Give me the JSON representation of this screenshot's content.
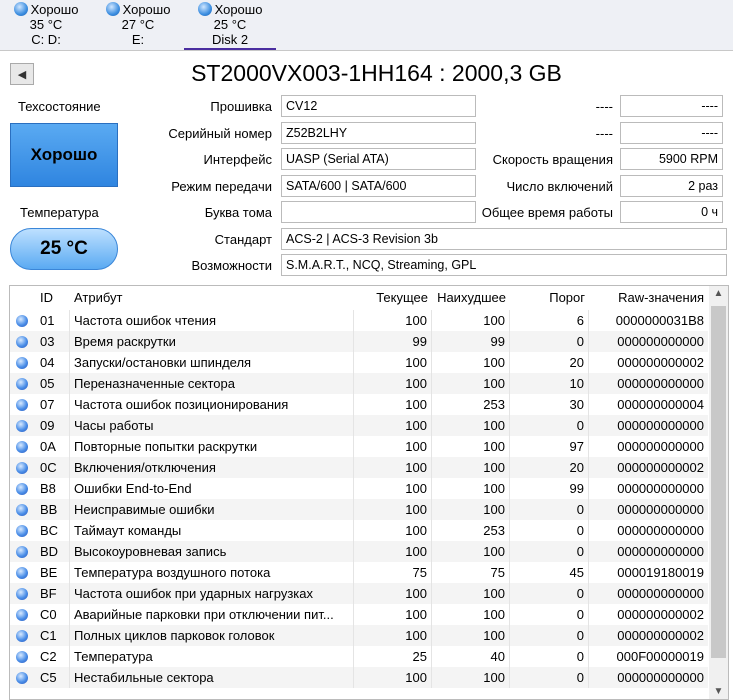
{
  "tabs": [
    {
      "status": "Хорошо",
      "temp": "35 °C",
      "drive": "C: D:"
    },
    {
      "status": "Хорошо",
      "temp": "27 °C",
      "drive": "E:"
    },
    {
      "status": "Хорошо",
      "temp": "25 °C",
      "drive": "Disk 2"
    }
  ],
  "title": "ST2000VX003-1HH164 : 2000,3 GB",
  "health_label": "Техсостояние",
  "health": "Хорошо",
  "temp_label": "Температура",
  "temp": "25 °C",
  "fields": [
    {
      "label": "Прошивка",
      "value": "CV12"
    },
    {
      "label": "Серийный номер",
      "value": "Z52B2LHY"
    },
    {
      "label": "Интерфейс",
      "value": "UASP (Serial ATA)"
    },
    {
      "label": "Режим передачи",
      "value": "SATA/600 | SATA/600"
    },
    {
      "label": "Буква тома",
      "value": ""
    },
    {
      "label": "Стандарт",
      "value": "ACS-2 | ACS-3 Revision 3b"
    },
    {
      "label": "Возможности",
      "value": "S.M.A.R.T., NCQ, Streaming, GPL"
    }
  ],
  "right_fields": [
    {
      "label": "----",
      "value": "----"
    },
    {
      "label": "----",
      "value": "----"
    },
    {
      "label": "Скорость вращения",
      "value": "5900 RPM"
    },
    {
      "label": "Число включений",
      "value": "2 раз"
    },
    {
      "label": "Общее время работы",
      "value": "0 ч"
    }
  ],
  "columns": [
    "ID",
    "Атрибут",
    "Текущее",
    "Наихудшее",
    "Порог",
    "Raw-значения"
  ],
  "rows": [
    [
      "01",
      "Частота ошибок чтения",
      "100",
      "100",
      "6",
      "0000000031B8"
    ],
    [
      "03",
      "Время раскрутки",
      "99",
      "99",
      "0",
      "000000000000"
    ],
    [
      "04",
      "Запуски/остановки шпинделя",
      "100",
      "100",
      "20",
      "000000000002"
    ],
    [
      "05",
      "Переназначенные сектора",
      "100",
      "100",
      "10",
      "000000000000"
    ],
    [
      "07",
      "Частота ошибок позиционирования",
      "100",
      "253",
      "30",
      "000000000004"
    ],
    [
      "09",
      "Часы работы",
      "100",
      "100",
      "0",
      "000000000000"
    ],
    [
      "0A",
      "Повторные попытки раскрутки",
      "100",
      "100",
      "97",
      "000000000000"
    ],
    [
      "0C",
      "Включения/отключения",
      "100",
      "100",
      "20",
      "000000000002"
    ],
    [
      "B8",
      "Ошибки End-to-End",
      "100",
      "100",
      "99",
      "000000000000"
    ],
    [
      "BB",
      "Неисправимые ошибки",
      "100",
      "100",
      "0",
      "000000000000"
    ],
    [
      "BC",
      "Таймаут команды",
      "100",
      "253",
      "0",
      "000000000000"
    ],
    [
      "BD",
      "Высокоуровневая запись",
      "100",
      "100",
      "0",
      "000000000000"
    ],
    [
      "BE",
      "Температура воздушного потока",
      "75",
      "75",
      "45",
      "000019180019"
    ],
    [
      "BF",
      "Частота ошибок при ударных нагрузках",
      "100",
      "100",
      "0",
      "000000000000"
    ],
    [
      "C0",
      "Аварийные парковки при отключении пит...",
      "100",
      "100",
      "0",
      "000000000002"
    ],
    [
      "C1",
      "Полных циклов парковок головок",
      "100",
      "100",
      "0",
      "000000000002"
    ],
    [
      "C2",
      "Температура",
      "25",
      "40",
      "0",
      "000F00000019"
    ],
    [
      "C5",
      "Нестабильные сектора",
      "100",
      "100",
      "0",
      "000000000000"
    ]
  ]
}
